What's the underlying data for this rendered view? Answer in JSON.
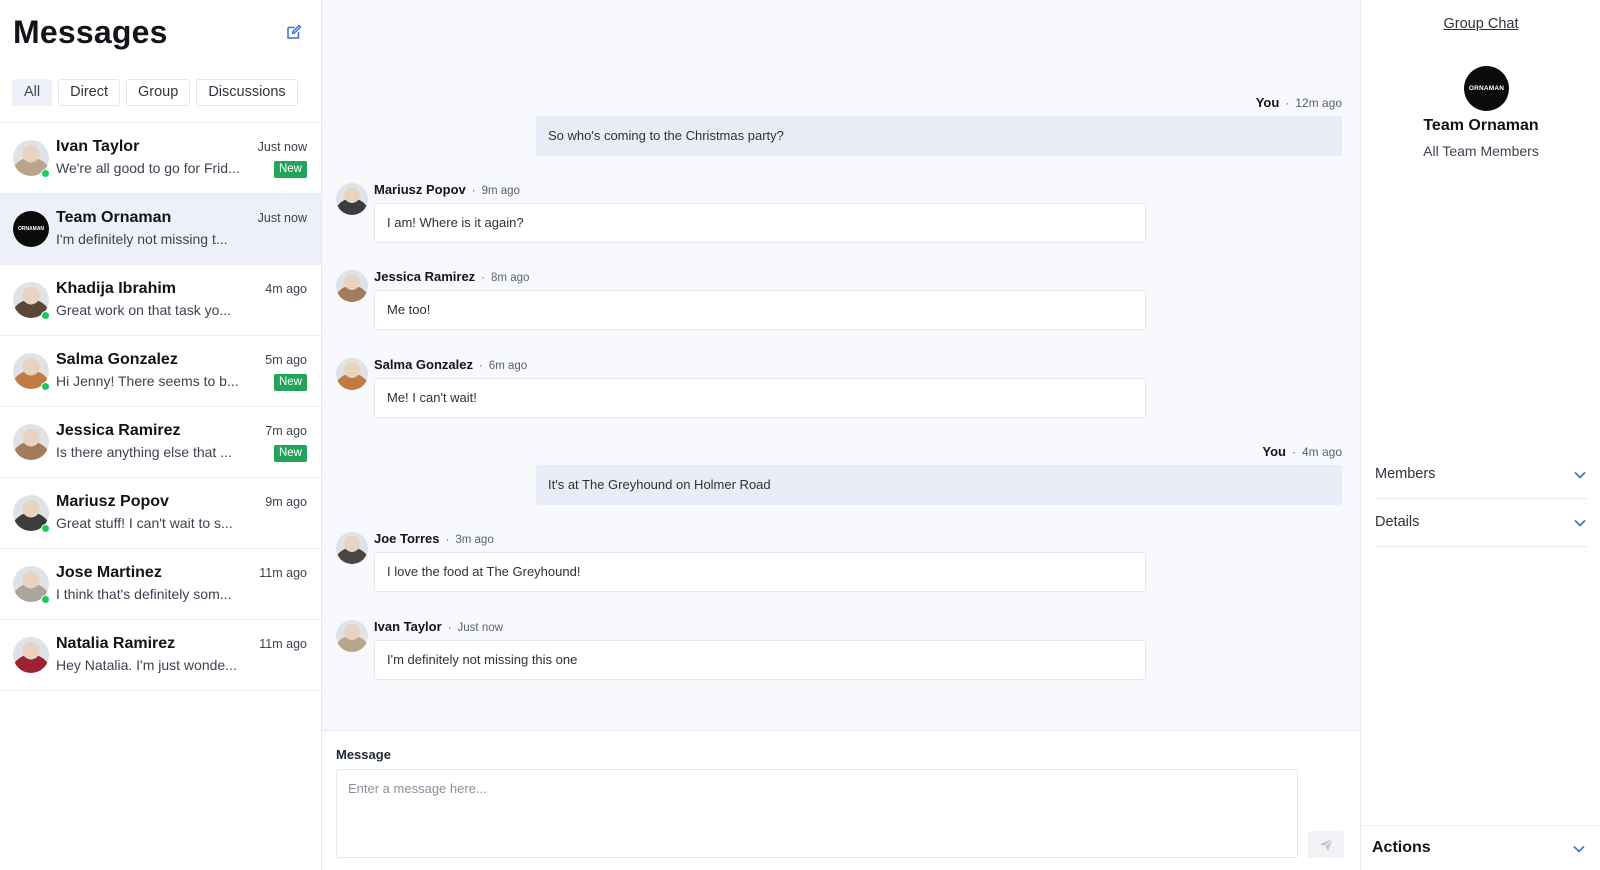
{
  "sidebar": {
    "title": "Messages",
    "filters": [
      "All",
      "Direct",
      "Group",
      "Discussions"
    ],
    "conversations": [
      {
        "name": "Ivan Taylor",
        "preview": "We're all good to go for Frid...",
        "time": "Just now",
        "badge": "New",
        "online": true,
        "avatar_color": "#b9a48c"
      },
      {
        "name": "Team Ornaman",
        "preview": "I'm definitely not missing t...",
        "time": "Just now",
        "badge": "",
        "online": false,
        "logo_text": "ORNAMAN"
      },
      {
        "name": "Khadija Ibrahim",
        "preview": "Great work on that task yo...",
        "time": "4m ago",
        "badge": "",
        "online": true,
        "avatar_color": "#5b4638"
      },
      {
        "name": "Salma Gonzalez",
        "preview": "Hi Jenny! There seems to b...",
        "time": "5m ago",
        "badge": "New",
        "online": true,
        "avatar_color": "#c07a42"
      },
      {
        "name": "Jessica Ramirez",
        "preview": "Is there anything else that ...",
        "time": "7m ago",
        "badge": "New",
        "online": false,
        "avatar_color": "#a27b5c"
      },
      {
        "name": "Mariusz Popov",
        "preview": "Great stuff! I can't wait to s...",
        "time": "9m ago",
        "badge": "",
        "online": true,
        "avatar_color": "#3c3c3c"
      },
      {
        "name": "Jose Martinez",
        "preview": "I think that's definitely som...",
        "time": "11m ago",
        "badge": "",
        "online": true,
        "avatar_color": "#a9a59e"
      },
      {
        "name": "Natalia Ramirez",
        "preview": "Hey Natalia. I'm just wonde...",
        "time": "11m ago",
        "badge": "",
        "online": false,
        "avatar_color": "#9e2233"
      }
    ]
  },
  "chat": {
    "messages": [
      {
        "self": true,
        "author": "You",
        "time": "12m ago",
        "text": "So who's coming to the Christmas party?"
      },
      {
        "self": false,
        "author": "Mariusz Popov",
        "time": "9m ago",
        "text": "I am! Where is it again?",
        "avatar_color": "#3c3c3c"
      },
      {
        "self": false,
        "author": "Jessica Ramirez",
        "time": "8m ago",
        "text": "Me too!",
        "avatar_color": "#a27b5c"
      },
      {
        "self": false,
        "author": "Salma Gonzalez",
        "time": "6m ago",
        "text": "Me! I can't wait!",
        "avatar_color": "#c07a42"
      },
      {
        "self": true,
        "author": "You",
        "time": "4m ago",
        "text": "It's at The Greyhound on Holmer Road"
      },
      {
        "self": false,
        "author": "Joe Torres",
        "time": "3m ago",
        "text": "I love the food at The Greyhound!",
        "avatar_color": "#4a4540"
      },
      {
        "self": false,
        "author": "Ivan Taylor",
        "time": "Just now",
        "text": "I'm definitely not missing this one",
        "avatar_color": "#b9a48c"
      }
    ],
    "separator": "·"
  },
  "composer": {
    "label": "Message",
    "placeholder": "Enter a message here..."
  },
  "right_panel": {
    "link": "Group Chat",
    "logo_text": "ORNAMAN",
    "group_name": "Team Ornaman",
    "subtitle": "All Team Members",
    "sections": [
      "Members",
      "Details"
    ],
    "actions_label": "Actions"
  }
}
